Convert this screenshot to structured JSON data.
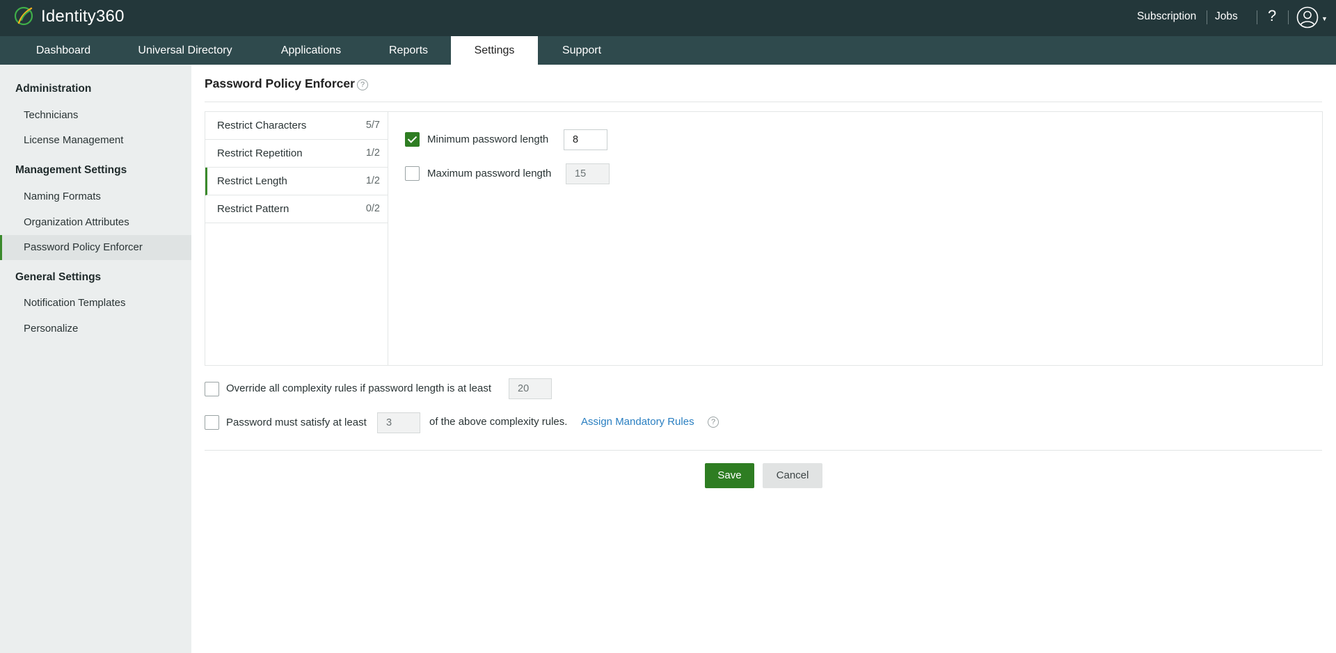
{
  "app": {
    "brand": "Identity360",
    "top_links": {
      "subscription": "Subscription",
      "jobs": "Jobs"
    },
    "help_symbol": "?",
    "icons": {
      "logo": "identity360-logo-icon",
      "help": "help-icon",
      "avatar": "user-avatar-icon",
      "caret": "chevron-down-icon"
    },
    "colors": {
      "topbar": "#23373a",
      "navbar": "#2f4a4d",
      "accent": "#2e7d22",
      "link": "#2a7fc1"
    }
  },
  "nav": {
    "tabs": [
      {
        "label": "Dashboard"
      },
      {
        "label": "Universal Directory"
      },
      {
        "label": "Applications"
      },
      {
        "label": "Reports"
      },
      {
        "label": "Settings",
        "active": true
      },
      {
        "label": "Support"
      }
    ]
  },
  "sidebar": {
    "sections": [
      {
        "heading": "Administration",
        "items": [
          "Technicians",
          "License Management"
        ]
      },
      {
        "heading": "Management Settings",
        "items": [
          "Naming Formats",
          "Organization Attributes",
          "Password Policy Enforcer"
        ]
      },
      {
        "heading": "General Settings",
        "items": [
          "Notification Templates",
          "Personalize"
        ]
      }
    ],
    "active_item": "Password Policy Enforcer"
  },
  "main": {
    "title": "Password Policy Enforcer",
    "help_symbol": "?",
    "rules": [
      {
        "label": "Restrict Characters",
        "count": "5/7"
      },
      {
        "label": "Restrict Repetition",
        "count": "1/2"
      },
      {
        "label": "Restrict Length",
        "count": "1/2",
        "active": true
      },
      {
        "label": "Restrict Pattern",
        "count": "0/2"
      }
    ],
    "length_options": {
      "min": {
        "label": "Minimum password length",
        "checked": true,
        "value": "8"
      },
      "max": {
        "label": "Maximum password length",
        "checked": false,
        "value": "15"
      }
    },
    "override": {
      "label": "Override all complexity rules if password length is at least",
      "checked": false,
      "value": "20"
    },
    "satisfy": {
      "label_before": "Password must satisfy at least",
      "value": "3",
      "label_after": "of the above complexity rules.",
      "link": "Assign Mandatory Rules",
      "checked": false
    },
    "buttons": {
      "save": "Save",
      "cancel": "Cancel"
    }
  }
}
